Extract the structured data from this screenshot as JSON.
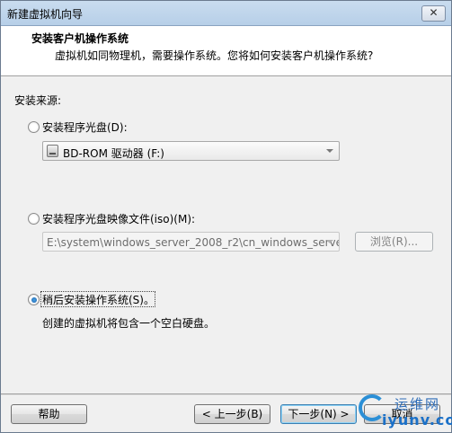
{
  "window": {
    "title": "新建虚拟机向导",
    "close_label": "✕"
  },
  "header": {
    "title": "安装客户机操作系统",
    "description": "虚拟机如同物理机，需要操作系统。您将如何安装客户机操作系统?"
  },
  "source": {
    "group_label": "安装来源:",
    "option_disc": {
      "label": "安装程序光盘(D):",
      "selected": false,
      "drive_value": "BD-ROM 驱动器 (F:)"
    },
    "option_iso": {
      "label": "安装程序光盘映像文件(iso)(M):",
      "selected": false,
      "path_value": "E:\\system\\windows_server_2008_r2\\cn_windows_serve",
      "browse_label": "浏览(R)..."
    },
    "option_later": {
      "label": "稍后安装操作系统(S)。",
      "selected": true,
      "description": "创建的虚拟机将包含一个空白硬盘。"
    }
  },
  "footer": {
    "help_label": "帮助",
    "back_label": "< 上一步(B)",
    "next_label": "下一步(N) >",
    "cancel_label": "取消"
  },
  "watermark": {
    "cn": "运维网",
    "en": "iyunv.com"
  }
}
